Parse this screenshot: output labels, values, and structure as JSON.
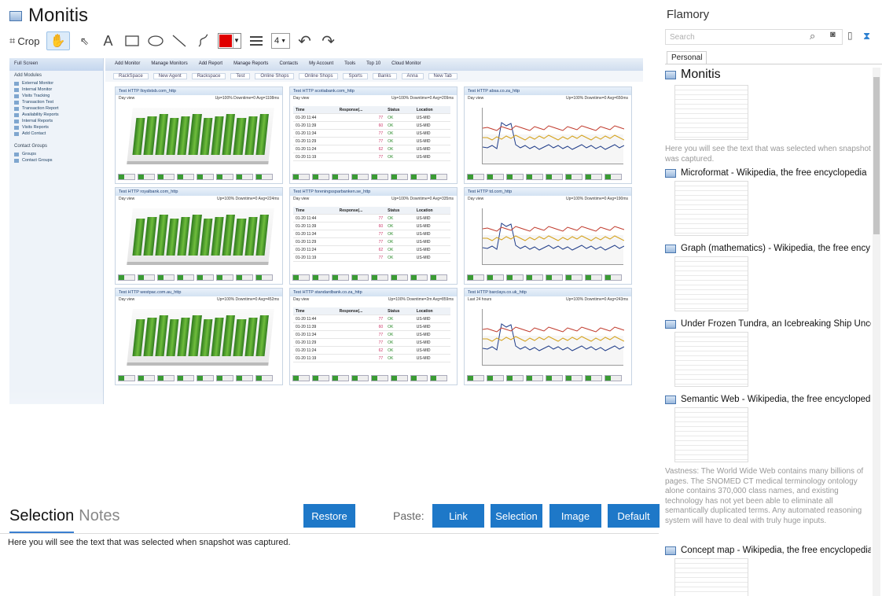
{
  "editor": {
    "title": "Monitis",
    "toolbar": {
      "crop_label": "Crop",
      "text_tool": "A",
      "line_width": "4",
      "color": "#e00000"
    }
  },
  "snapshot": {
    "nav": {
      "header": "Full Screen",
      "group1": "Add Modules",
      "items1": [
        "External Monitor",
        "Internal Monitor",
        "Visits Tracking",
        "Transaction Test",
        "Transaction Report",
        "Availability Reports",
        "Internal Reports",
        "Visits Reports",
        "Add Contact"
      ],
      "group2": "Contact Groups",
      "items2": [
        "Groups",
        "Contact Groups"
      ]
    },
    "menu": [
      "Add Monitor",
      "Manage Monitors",
      "Add Report",
      "Manage Reports",
      "Contacts",
      "My Account",
      "Tools",
      "Top 10",
      "Cloud Monitor"
    ],
    "tabs": [
      "RackSpace",
      "New Agent",
      "Rackspace",
      "Test",
      "Online Shops",
      "Online Shops",
      "Sports",
      "Banks",
      "Anna",
      "New Tab"
    ],
    "panels": [
      {
        "title": "Test HTTP lloydstsb.com_http",
        "view": "Day view",
        "stats": "Up=100% Downtime=0 Avg=1108ms",
        "kind": "bars"
      },
      {
        "title": "Test HTTP scotiabank.com_http",
        "view": "Day view",
        "stats": "Up=100% Downtime=0 Avg=209ms",
        "kind": "table"
      },
      {
        "title": "Test HTTP absa.co.za_http",
        "view": "Day view",
        "stats": "Up=100% Downtime=0 Avg=650ms",
        "kind": "line"
      },
      {
        "title": "Test HTTP royalbank.com_http",
        "view": "Day view",
        "stats": "Up=100% Downtime=0 Avg=224ms",
        "kind": "bars"
      },
      {
        "title": "Test HTTP foreningssparbanken.se_http",
        "view": "Day view",
        "stats": "Up=100% Downtime=0 Avg=335ms",
        "kind": "table"
      },
      {
        "title": "Test HTTP td.com_http",
        "view": "Day view",
        "stats": "Up=100% Downtime=0 Avg=190ms",
        "kind": "line"
      },
      {
        "title": "Test HTTP westpac.com.au_http",
        "view": "Day view",
        "stats": "Up=100% Downtime=0 Avg=452ms",
        "kind": "bars"
      },
      {
        "title": "Test HTTP standardbank.co.za_http",
        "view": "Day view",
        "stats": "Up=100% Downtime=2m Avg=859ms",
        "kind": "table"
      },
      {
        "title": "Test HTTP barclays.co.uk_http",
        "view": "Last 24 hours",
        "stats": "Up=100% Downtime=0 Avg=243ms",
        "kind": "line"
      }
    ],
    "table_headers": [
      "Time",
      "Response(...",
      "Status",
      "Location"
    ],
    "table_rows": [
      [
        "01-20 11:44",
        "77",
        "OK",
        "US-MID"
      ],
      [
        "01-20 11:39",
        "60",
        "OK",
        "US-MID"
      ],
      [
        "01-20 11:34",
        "77",
        "OK",
        "US-MID"
      ],
      [
        "01-20 11:29",
        "77",
        "OK",
        "US-MID"
      ],
      [
        "01-20 11:24",
        "62",
        "OK",
        "US-MID"
      ],
      [
        "01-20 11:19",
        "77",
        "OK",
        "US-MID"
      ]
    ]
  },
  "selection": {
    "tab_active": "Selection",
    "tab_inactive": "Notes",
    "restore_label": "Restore",
    "paste_label": "Paste:",
    "link_label": "Link",
    "selection_label": "Selection",
    "image_label": "Image",
    "default_label": "Default",
    "text": "Here you will see the text that was selected when snapshot was captured."
  },
  "sidebar": {
    "title": "Flamory",
    "search_placeholder": "Search",
    "tab": "Personal",
    "items": [
      {
        "title": "Monitis",
        "caption": "Here you will see the text that was selected when snapshot was captured."
      },
      {
        "title": "Microformat - Wikipedia, the free encyclopedia",
        "caption": ""
      },
      {
        "title": "Graph (mathematics) - Wikipedia, the free ency",
        "caption": ""
      },
      {
        "title": "Under Frozen Tundra, an Icebreaking Ship Unco",
        "caption": ""
      },
      {
        "title": "Semantic Web - Wikipedia, the free encycloped",
        "caption": "Vastness: The World Wide Web contains many billions of pages. The SNOMED CT medical terminology ontology alone contains 370,000 class names, and existing technology has not yet been able to eliminate all semantically duplicated terms. Any automated reasoning system will have to deal with truly huge inputs."
      },
      {
        "title": "Concept map - Wikipedia, the free encyclopedia",
        "caption": ""
      }
    ]
  }
}
